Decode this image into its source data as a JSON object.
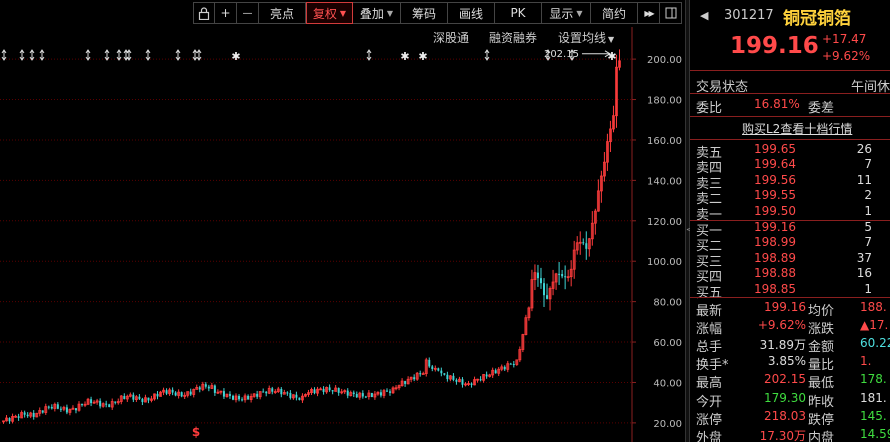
{
  "toolbar": {
    "lock_icon": "lock-icon",
    "zoom_in": "+",
    "zoom_out": "—",
    "buttons": [
      {
        "label": "亮点",
        "caret": false
      },
      {
        "label": "复权",
        "caret": true,
        "active": true
      },
      {
        "label": "叠加",
        "caret": true
      },
      {
        "label": "筹码",
        "caret": false
      },
      {
        "label": "画线",
        "caret": false
      },
      {
        "label": "PK",
        "caret": false
      },
      {
        "label": "显示",
        "caret": true
      },
      {
        "label": "简约",
        "caret": false
      }
    ],
    "nav_forward": "▶▶",
    "nav_icon": "expand-right-icon"
  },
  "chart_links": {
    "shengutong": "深股通",
    "rongzi": "融资融券",
    "settings": "设置均线"
  },
  "chart_data": {
    "type": "candlestick",
    "y_ticks": [
      "200.00",
      "180.00",
      "160.00",
      "140.00",
      "120.00",
      "100.00",
      "80.00",
      "60.00",
      "40.00",
      "20.00"
    ],
    "ylim": [
      14,
      206
    ],
    "high_annotation": "202.15",
    "marker_glyph": "$",
    "colors": {
      "up": "#ff3c3c",
      "down": "#3fd5d5",
      "grid": "#5a0000",
      "axis": "#8a1f1f"
    }
  },
  "stock": {
    "code": "301217",
    "name": "铜冠铜箔",
    "price": "199.16",
    "change": "+17.47",
    "change_pct": "+9.62%"
  },
  "trade_status": {
    "label": "交易状态",
    "value": "午间休"
  },
  "weibi": {
    "label": "委比",
    "value": "16.81%",
    "diff_label": "委差"
  },
  "l2_link": "购买L2查看十档行情",
  "sell": [
    {
      "name": "卖五",
      "price": "199.65",
      "vol": "26"
    },
    {
      "name": "卖四",
      "price": "199.64",
      "vol": "7"
    },
    {
      "name": "卖三",
      "price": "199.56",
      "vol": "11"
    },
    {
      "name": "卖二",
      "price": "199.55",
      "vol": "2"
    },
    {
      "name": "卖一",
      "price": "199.50",
      "vol": "1"
    }
  ],
  "buy": [
    {
      "name": "买一",
      "price": "199.16",
      "vol": "5"
    },
    {
      "name": "买二",
      "price": "198.99",
      "vol": "7"
    },
    {
      "name": "买三",
      "price": "198.89",
      "vol": "37"
    },
    {
      "name": "买四",
      "price": "198.88",
      "vol": "16"
    },
    {
      "name": "买五",
      "price": "198.85",
      "vol": "1"
    }
  ],
  "stats": [
    {
      "l1": "最新",
      "v1": "199.16",
      "c1": "red",
      "l2": "均价",
      "v2": "188.",
      "c2": "red"
    },
    {
      "l1": "涨幅",
      "v1": "+9.62%",
      "c1": "red",
      "l2": "涨跌",
      "v2": "▲17.",
      "c2": "red"
    },
    {
      "l1": "总手",
      "v1": "31.89万",
      "c1": "white",
      "l2": "金额",
      "v2": "60.22",
      "c2": "cyan"
    },
    {
      "l1": "换手*",
      "v1": "3.85%",
      "c1": "white",
      "l2": "量比",
      "v2": "1.",
      "c2": "red"
    },
    {
      "l1": "最高",
      "v1": "202.15",
      "c1": "red",
      "l2": "最低",
      "v2": "178.",
      "c2": "green"
    },
    {
      "l1": "今开",
      "v1": "179.30",
      "c1": "green",
      "l2": "昨收",
      "v2": "181.",
      "c2": "white"
    },
    {
      "l1": "涨停",
      "v1": "218.03",
      "c1": "red",
      "l2": "跌停",
      "v2": "145.",
      "c2": "green"
    },
    {
      "l1": "外盘",
      "v1": "17.30万",
      "c1": "red",
      "l2": "内盘",
      "v2": "14.59",
      "c2": "green"
    }
  ]
}
